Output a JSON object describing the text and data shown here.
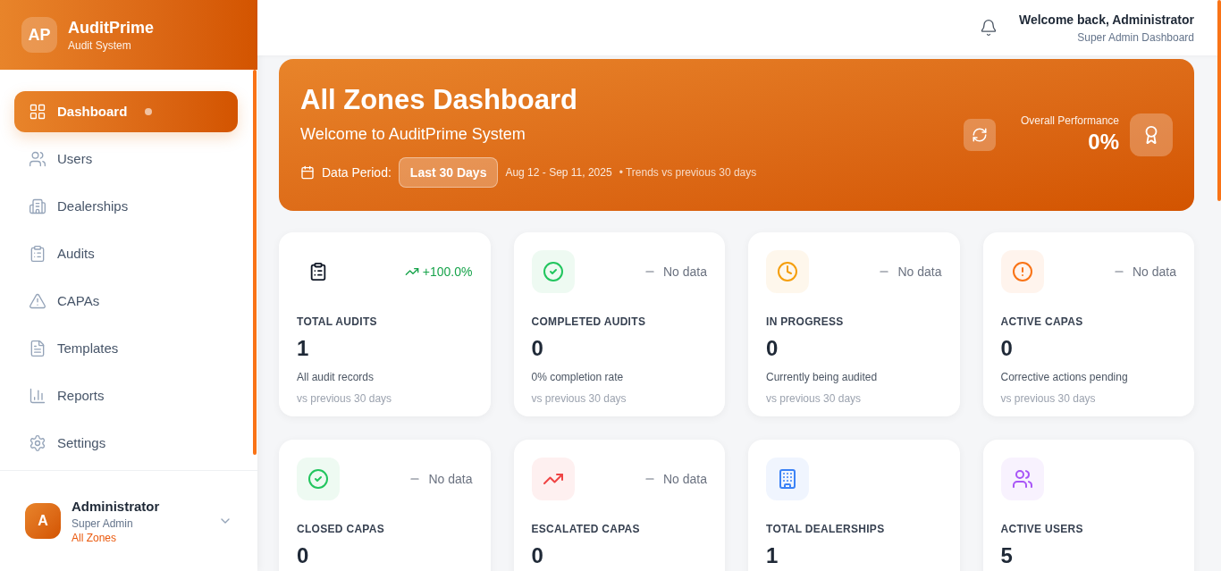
{
  "sidebar": {
    "logo": {
      "initials": "AP",
      "title": "AuditPrime",
      "subtitle": "Audit System"
    },
    "items": [
      {
        "label": "Dashboard",
        "selected": true
      },
      {
        "label": "Users",
        "selected": false
      },
      {
        "label": "Dealerships",
        "selected": false
      },
      {
        "label": "Audits",
        "selected": false
      },
      {
        "label": "CAPAs",
        "selected": false
      },
      {
        "label": "Templates",
        "selected": false
      },
      {
        "label": "Reports",
        "selected": false
      },
      {
        "label": "Settings",
        "selected": false
      }
    ],
    "user": {
      "initial": "A",
      "name": "Administrator",
      "role": "Super Admin",
      "zone": "All Zones"
    }
  },
  "header": {
    "greeting": "Welcome back, Administrator",
    "subtitle": "Super Admin Dashboard"
  },
  "hero": {
    "title": "All Zones Dashboard",
    "subtitle": "Welcome to AuditPrime System",
    "period_label": "Data Period:",
    "period_button": "Last 30 Days",
    "date_range": "Aug 12 - Sep 11, 2025",
    "trend_note": "• Trends vs previous 30 days",
    "performance_label": "Overall Performance",
    "performance_value": "0%"
  },
  "cards": [
    {
      "title": "TOTAL AUDITS",
      "value": "1",
      "description": "All audit records",
      "comparison": "vs previous 30 days",
      "trend": "+100.0%",
      "kind": "up",
      "color": "#111827"
    },
    {
      "title": "COMPLETED AUDITS",
      "value": "0",
      "description": "0% completion rate",
      "comparison": "vs previous 30 days",
      "trend": "No data",
      "kind": "none",
      "color": "#22c55e"
    },
    {
      "title": "IN PROGRESS",
      "value": "0",
      "description": "Currently being audited",
      "comparison": "vs previous 30 days",
      "trend": "No data",
      "kind": "none",
      "color": "#f59e0b"
    },
    {
      "title": "ACTIVE CAPAS",
      "value": "0",
      "description": "Corrective actions pending",
      "comparison": "vs previous 30 days",
      "trend": "No data",
      "kind": "none",
      "color": "#f97316"
    },
    {
      "title": "CLOSED CAPAS",
      "value": "0",
      "trend": "No data",
      "kind": "none",
      "color": "#22c55e"
    },
    {
      "title": "ESCALATED CAPAS",
      "value": "0",
      "trend": "No data",
      "kind": "none",
      "color": "#ef4444"
    },
    {
      "title": "TOTAL DEALERSHIPS",
      "value": "1",
      "kind": "plain",
      "color": "#3b82f6"
    },
    {
      "title": "ACTIVE USERS",
      "value": "5",
      "kind": "plain",
      "color": "#a855f7"
    }
  ]
}
